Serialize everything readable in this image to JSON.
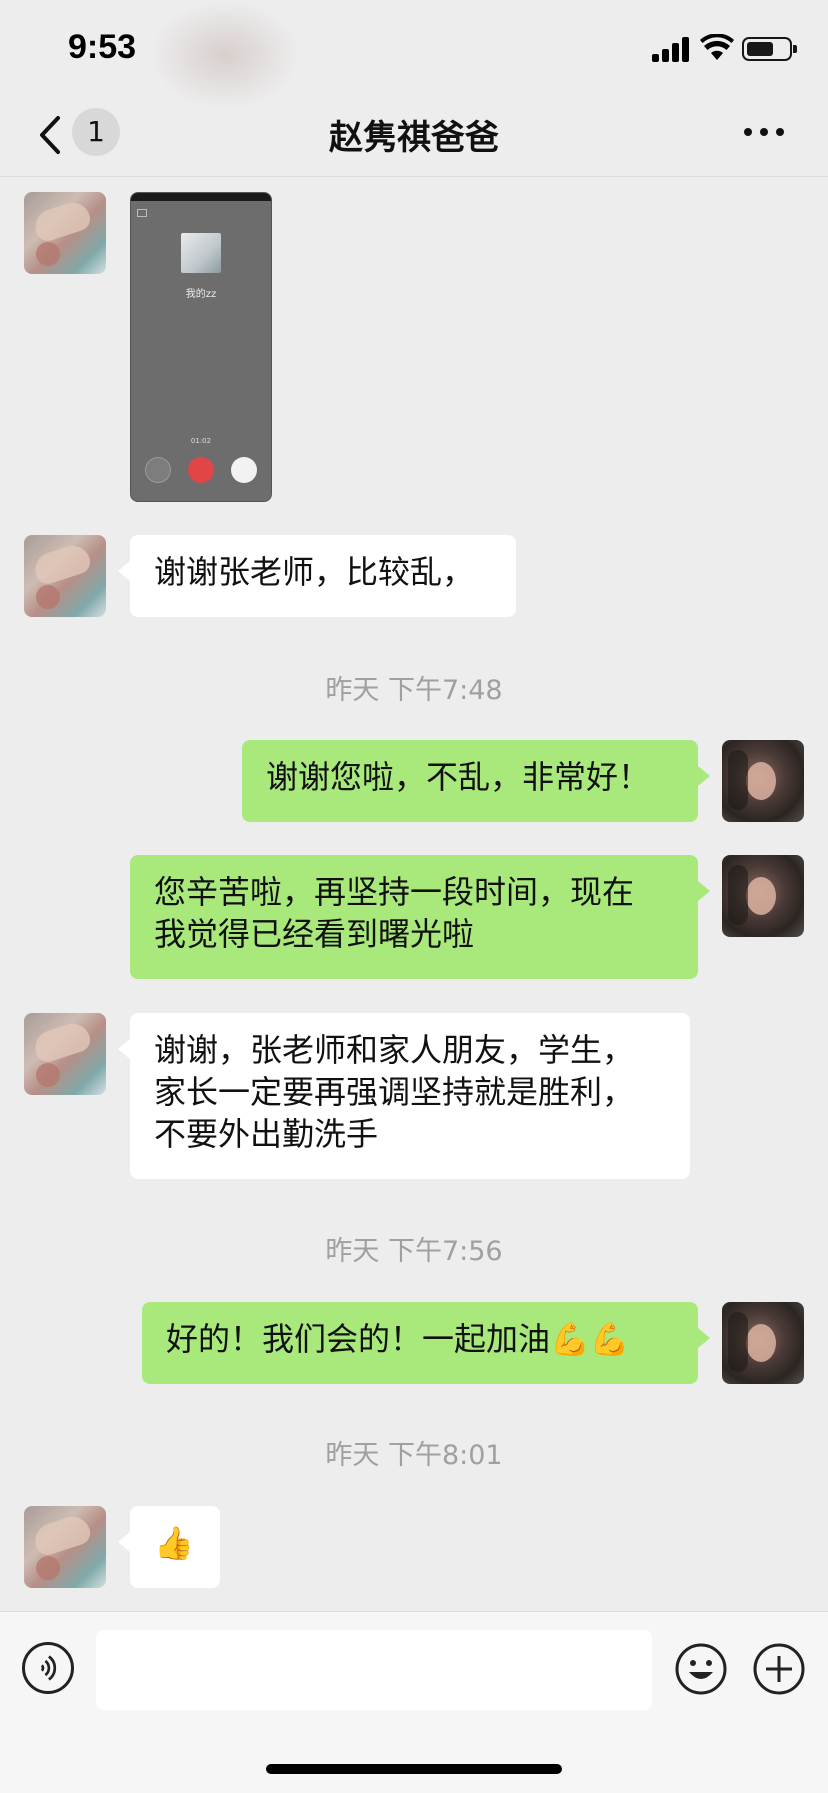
{
  "status_bar": {
    "time": "9:53"
  },
  "nav": {
    "unread_count": "1",
    "title": "赵隽祺爸爸"
  },
  "thumbnail": {
    "contact_name": "我的zz",
    "call_duration": "01:02"
  },
  "messages": [
    {
      "side": "left",
      "text": "谢谢张老师，比较乱，"
    },
    {
      "timestamp": "昨天 下午7:48"
    },
    {
      "side": "right",
      "text": "谢谢您啦，不乱，非常好！"
    },
    {
      "side": "right",
      "text": "您辛苦啦，再坚持一段时间，现在\n我觉得已经看到曙光啦"
    },
    {
      "side": "left",
      "text": "谢谢，张老师和家人朋友，学生，\n家长一定要再强调坚持就是胜利，\n不要外出勤洗手"
    },
    {
      "timestamp": "昨天 下午7:56"
    },
    {
      "side": "right",
      "text": "好的！我们会的！一起加油💪💪"
    },
    {
      "timestamp": "昨天 下午8:01"
    },
    {
      "side": "left",
      "text": "👍"
    }
  ],
  "input": {
    "placeholder": ""
  },
  "colors": {
    "background": "#ededed",
    "self_bubble": "#a9e97b",
    "other_bubble": "#ffffff",
    "timestamp": "#a0a0a0"
  }
}
